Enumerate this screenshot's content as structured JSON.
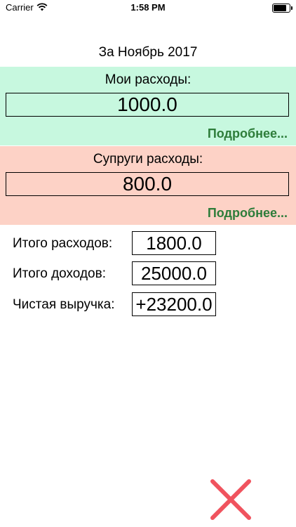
{
  "status_bar": {
    "carrier": "Carrier",
    "time": "1:58 PM",
    "battery_level": 0.9
  },
  "period": {
    "title": "За Ноябрь 2017"
  },
  "my_expenses": {
    "label": "Мои расходы:",
    "amount": "1000.0",
    "more_link": "Подробнее..."
  },
  "spouse_expenses": {
    "label": "Супруги расходы:",
    "amount": "800.0",
    "more_link": "Подробнее..."
  },
  "summary": {
    "total_expenses_label": "Итого расходов:",
    "total_expenses_value": "1800.0",
    "total_income_label": "Итого доходов:",
    "total_income_value": "25000.0",
    "net_profit_label": "Чистая выручка:",
    "net_profit_value": "+23200.0"
  },
  "colors": {
    "my_section_bg": "#c7f8df",
    "spouse_section_bg": "#fdd2c6",
    "link_green": "#2e7d3a",
    "close_red": "#f0535e"
  },
  "icons": {
    "close": "close-x-icon",
    "wifi": "wifi-icon",
    "battery": "battery-icon"
  }
}
